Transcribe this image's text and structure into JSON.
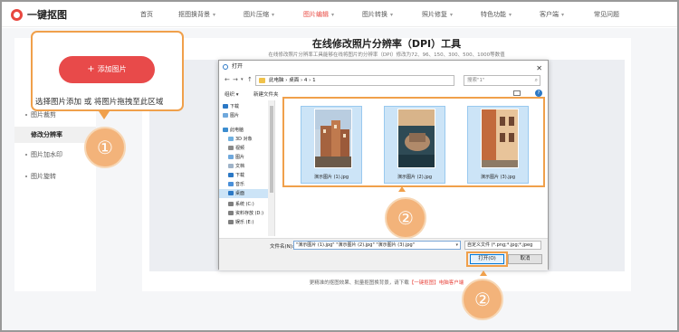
{
  "header": {
    "logo_text": "一键抠图",
    "nav": [
      {
        "label": "首页",
        "dropdown": false,
        "active": false
      },
      {
        "label": "抠图换背景",
        "dropdown": true,
        "active": false
      },
      {
        "label": "图片压缩",
        "dropdown": true,
        "active": false
      },
      {
        "label": "图片编辑",
        "dropdown": true,
        "active": true
      },
      {
        "label": "图片转换",
        "dropdown": true,
        "active": false
      },
      {
        "label": "照片修复",
        "dropdown": true,
        "active": false
      },
      {
        "label": "特色功能",
        "dropdown": true,
        "active": false
      },
      {
        "label": "客户端",
        "dropdown": true,
        "active": false
      },
      {
        "label": "常见问题",
        "dropdown": false,
        "active": false
      }
    ]
  },
  "sidebar": {
    "items": [
      {
        "label": "图片裁剪",
        "active": false
      },
      {
        "label": "修改分辨率",
        "active": true
      },
      {
        "label": "图片加水印",
        "active": false
      },
      {
        "label": "图片旋转",
        "active": false
      }
    ]
  },
  "main": {
    "title": "在线修改照片分辨率（DPI）工具",
    "subtitle": "在线修改照片分辨率工具能够在线将图片的分辨率（DPI）修改为72、96、150、300、500、1000等数值",
    "footer_prefix": "更精准的抠图效果、批量抠图换背景，请下载",
    "footer_link": "【一键抠图】电脑客户端"
  },
  "upload": {
    "button_label": "添加图片",
    "hint": "选择图片添加 或 将图片拖拽至此区域"
  },
  "badges": {
    "step1": "①",
    "step2": "②"
  },
  "dialog": {
    "title": "打开",
    "address": "此电脑 › 桌面 › 4 › 1",
    "search_placeholder": "搜索\"1\"",
    "organize": "组织 ▾",
    "new_folder": "新建文件夹",
    "tree": [
      "下载",
      "图片",
      "此电脑",
      "3D 对象",
      "视频",
      "图片",
      "文档",
      "下载",
      "音乐",
      "桌面",
      "系统 (C:)",
      "资料存放 (D:)",
      "娱乐 (E:)"
    ],
    "files": [
      "演示图片 (1).jpg",
      "演示图片 (2).jpg",
      "演示图片 (3).jpg"
    ],
    "filename_label": "文件名(N):",
    "filename_value": "\"演示图片 (1).jpg\" \"演示图片 (2).jpg\" \"演示图片 (3).jpg\"",
    "filter_value": "自定义文件 (*.png;*.jpg;*.jpeg",
    "open_label": "打开(O)",
    "cancel_label": "取消"
  },
  "colors": {
    "brand": "#e8473f",
    "highlight": "#f0a04b",
    "badge": "#f3b37a",
    "selection": "#cce4f7"
  }
}
